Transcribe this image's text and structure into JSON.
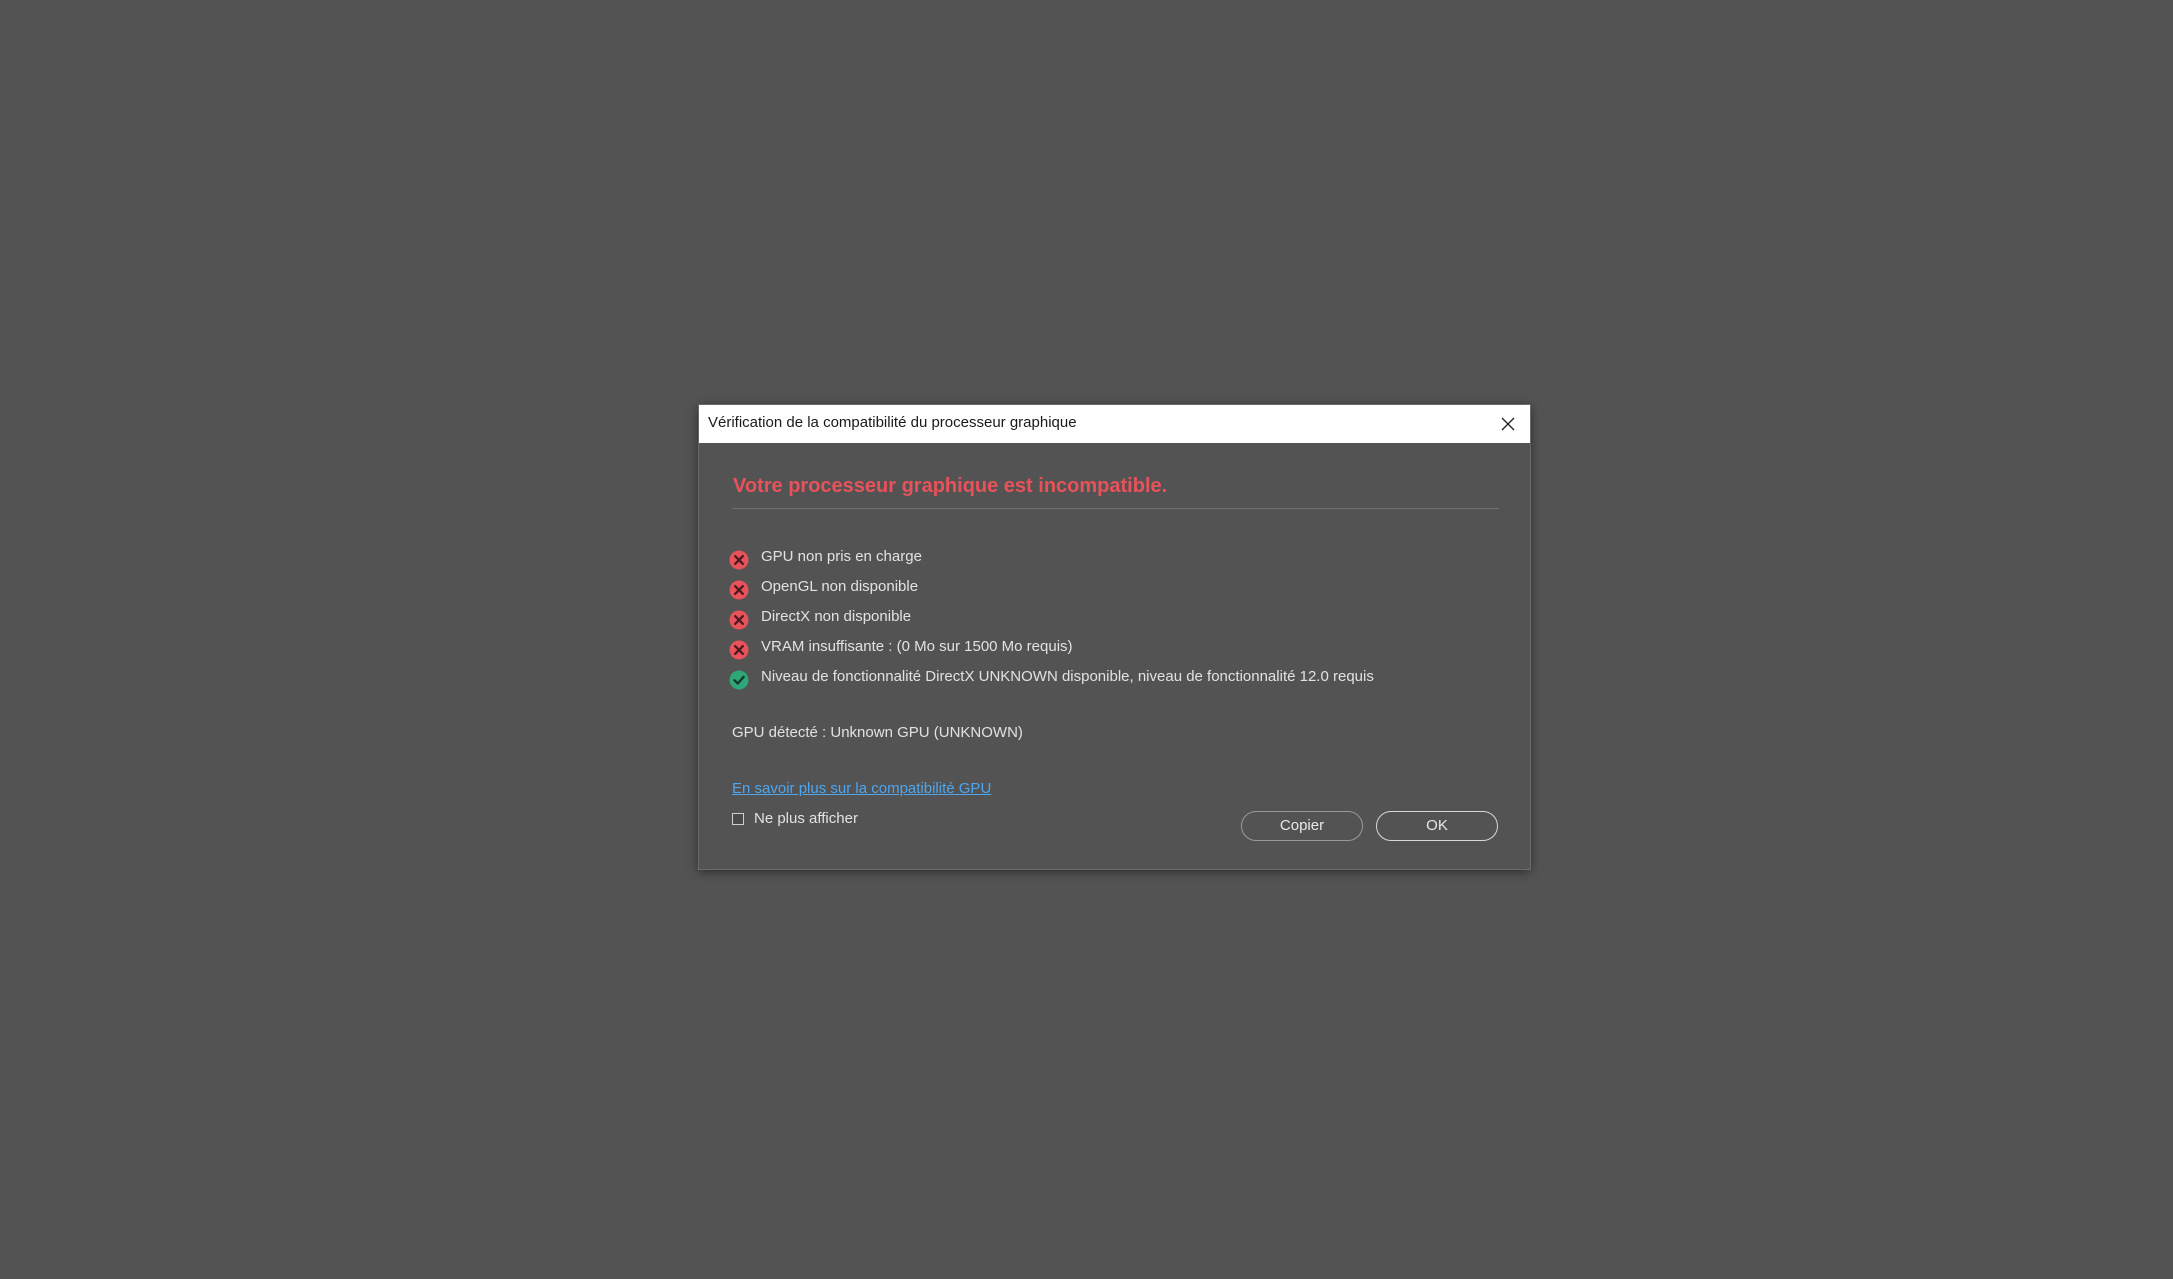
{
  "dialog": {
    "title": "Vérification de la compatibilité du processeur graphique",
    "close_icon": "close-icon",
    "headline": "Votre processeur graphique est incompatible.",
    "headline_color": "#e8525a",
    "checks": [
      {
        "status": "fail",
        "icon": "error-circle-icon",
        "text": "GPU non pris en charge"
      },
      {
        "status": "fail",
        "icon": "error-circle-icon",
        "text": "OpenGL non disponible"
      },
      {
        "status": "fail",
        "icon": "error-circle-icon",
        "text": "DirectX non disponible"
      },
      {
        "status": "fail",
        "icon": "error-circle-icon",
        "text": "VRAM insuffisante : (0 Mo sur 1500 Mo requis)"
      },
      {
        "status": "pass",
        "icon": "success-check-icon",
        "text": "Niveau de fonctionnalité DirectX UNKNOWN disponible, niveau de fonctionnalité 12.0 requis"
      }
    ],
    "fail_color": "#e8525a",
    "pass_color": "#2ea878",
    "gpu_detected": "GPU détecté : Unknown GPU (UNKNOWN)",
    "learn_more_link": "En savoir plus sur la compatibilité GPU",
    "link_color": "#4ea6ef",
    "dont_show_label": "Ne plus afficher",
    "dont_show_checked": false,
    "copy_button": "Copier",
    "ok_button": "OK"
  }
}
